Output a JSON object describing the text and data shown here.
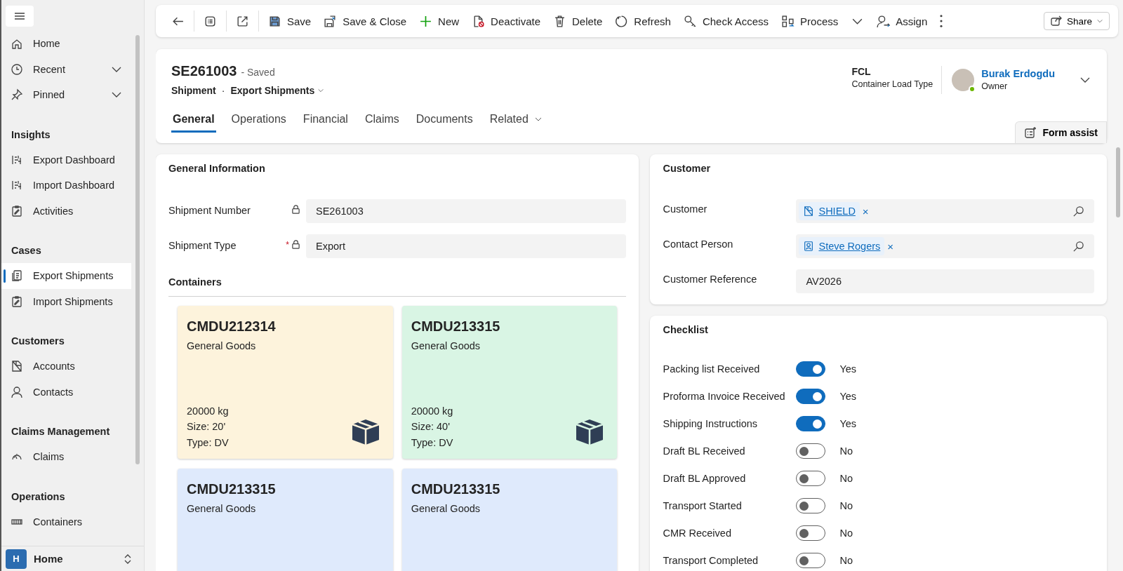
{
  "sidebar": {
    "groups": [
      {
        "items": [
          {
            "label": "Home",
            "kind": "home",
            "selected": false
          },
          {
            "label": "Recent",
            "kind": "clock",
            "selected": false,
            "expanded": false
          },
          {
            "label": "Pinned",
            "kind": "pin",
            "selected": false,
            "expanded": false
          }
        ]
      },
      {
        "title": "Insights",
        "items": [
          {
            "label": "Export Dashboard",
            "kind": "dashboard",
            "selected": false
          },
          {
            "label": "Import Dashboard",
            "kind": "dashboard",
            "selected": false
          },
          {
            "label": "Activities",
            "kind": "clipboard",
            "selected": false
          }
        ]
      },
      {
        "title": "Cases",
        "items": [
          {
            "label": "Export Shipments",
            "kind": "document",
            "selected": true
          },
          {
            "label": "Import Shipments",
            "kind": "clipboard",
            "selected": false
          }
        ]
      },
      {
        "title": "Customers",
        "items": [
          {
            "label": "Accounts",
            "kind": "account",
            "selected": false
          },
          {
            "label": "Contacts",
            "kind": "person",
            "selected": false
          }
        ]
      },
      {
        "title": "Claims Management",
        "items": [
          {
            "label": "Claims",
            "kind": "gauge",
            "selected": false
          }
        ]
      },
      {
        "title": "Operations",
        "items": [
          {
            "label": "Containers",
            "kind": "container",
            "selected": false
          }
        ]
      }
    ],
    "footer": {
      "badge": "H",
      "label": "Home"
    }
  },
  "toolbar": {
    "items": [
      {
        "kind": "back"
      },
      {
        "kind": "divider"
      },
      {
        "kind": "list"
      },
      {
        "kind": "divider"
      },
      {
        "kind": "popout"
      },
      {
        "kind": "divider"
      },
      {
        "kind": "save",
        "label": "Save"
      },
      {
        "kind": "saveclose",
        "label": "Save & Close"
      },
      {
        "kind": "new",
        "label": "New"
      },
      {
        "kind": "deactivate",
        "label": "Deactivate"
      },
      {
        "kind": "delete",
        "label": "Delete"
      },
      {
        "kind": "refresh",
        "label": "Refresh"
      },
      {
        "kind": "key",
        "label": "Check Access"
      },
      {
        "kind": "process",
        "label": "Process",
        "menu": true
      },
      {
        "kind": "assign",
        "label": "Assign"
      },
      {
        "kind": "more"
      }
    ],
    "share": {
      "label": "Share"
    }
  },
  "header": {
    "title": "SE261003",
    "status": "- Saved",
    "entity": "Shipment",
    "separator": "·",
    "form": "Export Shipments",
    "fields": [
      {
        "value": "FCL",
        "label": "Container Load Type"
      }
    ],
    "owner": {
      "name": "Burak Erdogdu",
      "role": "Owner"
    },
    "tabs": [
      {
        "label": "General",
        "selected": true
      },
      {
        "label": "Operations",
        "selected": false
      },
      {
        "label": "Financial",
        "selected": false
      },
      {
        "label": "Claims",
        "selected": false
      },
      {
        "label": "Documents",
        "selected": false
      },
      {
        "label": "Related",
        "selected": false,
        "menu": true
      }
    ],
    "form_assist": {
      "label": "Form assist"
    }
  },
  "general_information": {
    "title": "General Information",
    "fields": [
      {
        "label": "Shipment Number",
        "locked": true,
        "value": "SE261003"
      },
      {
        "label": "Shipment Type",
        "required_mark": "*",
        "locked": true,
        "value": "Export"
      }
    ],
    "containers": {
      "title": "Containers",
      "cards": [
        {
          "number": "CMDU212314",
          "goods": "General Goods",
          "weight": "20000 kg",
          "size": "Size: 20'",
          "type": "Type: DV",
          "color": "#fdf3dc"
        },
        {
          "number": "CMDU213315",
          "goods": "General Goods",
          "weight": "20000 kg",
          "size": "Size: 40'",
          "type": "Type: DV",
          "color": "#d9f5e4"
        },
        {
          "number": "CMDU213315",
          "goods": "General Goods",
          "color": "#dfeafc"
        },
        {
          "number": "CMDU213315",
          "goods": "General Goods",
          "color": "#dfeafc"
        }
      ]
    }
  },
  "customer": {
    "title": "Customer",
    "fields": [
      {
        "kind": "lookup",
        "label": "Customer",
        "tag": {
          "text": "SHIELD",
          "kind": "account",
          "remove": "×"
        }
      },
      {
        "kind": "lookup",
        "label": "Contact Person",
        "tag": {
          "text": "Steve Rogers",
          "kind": "contact",
          "remove": "×"
        }
      },
      {
        "kind": "text",
        "label": "Customer Reference",
        "value": "AV2026"
      }
    ]
  },
  "checklist": {
    "title": "Checklist",
    "items": [
      {
        "label": "Packing list Received",
        "checked": true,
        "value": "Yes"
      },
      {
        "label": "Proforma Invoice Received",
        "checked": true,
        "value": "Yes"
      },
      {
        "label": "Shipping Instructions",
        "checked": true,
        "value": "Yes"
      },
      {
        "label": "Draft BL Received",
        "checked": false,
        "value": "No"
      },
      {
        "label": "Draft BL Approved",
        "checked": false,
        "value": "No"
      },
      {
        "label": "Transport Started",
        "checked": false,
        "value": "No"
      },
      {
        "label": "CMR Received",
        "checked": false,
        "value": "No"
      },
      {
        "label": "Transport Completed",
        "checked": false,
        "value": "No"
      }
    ]
  }
}
